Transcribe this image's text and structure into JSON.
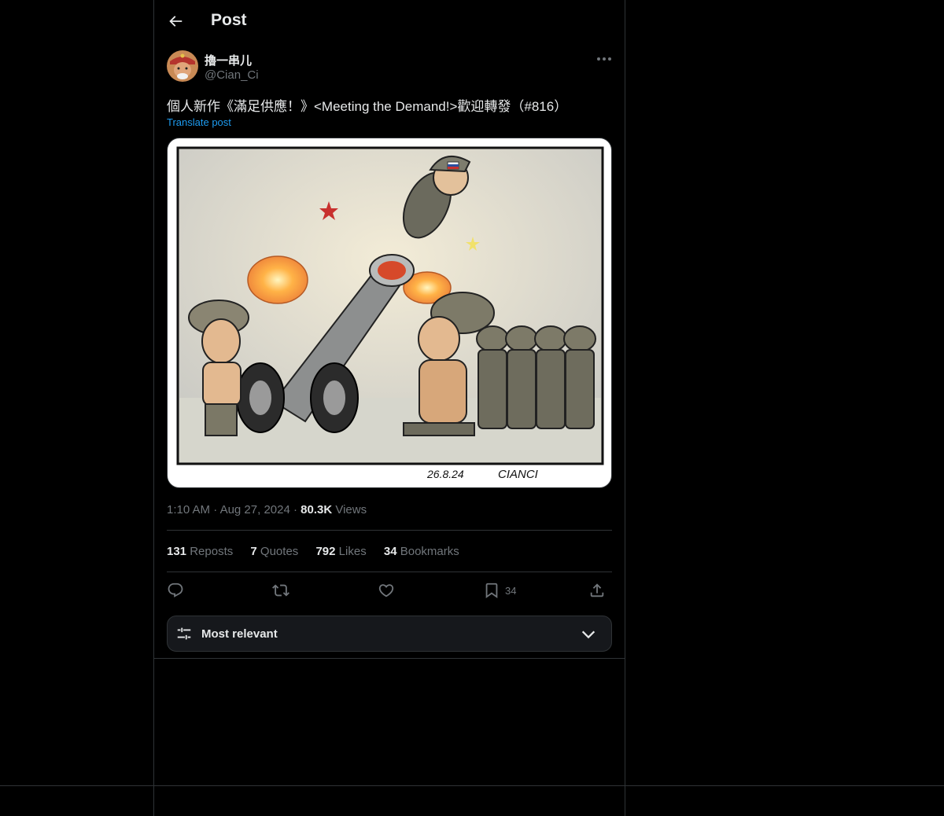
{
  "header": {
    "title": "Post"
  },
  "author": {
    "display_name": "擼一串儿",
    "handle": "@Cian_Ci"
  },
  "post": {
    "text": "個人新作《滿足供應！》<Meeting the Demand!>歡迎轉發（#816）",
    "translate_label": "Translate post",
    "image_signature": "CIANCI",
    "image_date": "26.8.24"
  },
  "meta": {
    "time": "1:10 AM",
    "sep1": "·",
    "date": "Aug 27, 2024",
    "sep2": "·",
    "views_count": "80.3K",
    "views_label": "Views"
  },
  "stats": {
    "reposts_count": "131",
    "reposts_label": "Reposts",
    "quotes_count": "7",
    "quotes_label": "Quotes",
    "likes_count": "792",
    "likes_label": "Likes",
    "bookmarks_count": "34",
    "bookmarks_label": "Bookmarks"
  },
  "actions": {
    "reply_icon": "reply-icon",
    "repost_icon": "repost-icon",
    "like_icon": "heart-icon",
    "bookmark_icon": "bookmark-icon",
    "bookmark_count": "34",
    "share_icon": "share-icon"
  },
  "sort": {
    "label": "Most relevant",
    "icon": "sliders-icon",
    "chevron": "chevron-down-icon"
  },
  "colors": {
    "background": "#000000",
    "text": "#e7e9ea",
    "muted": "#71767b",
    "accent": "#1d9bf0",
    "border": "#2f3336"
  }
}
